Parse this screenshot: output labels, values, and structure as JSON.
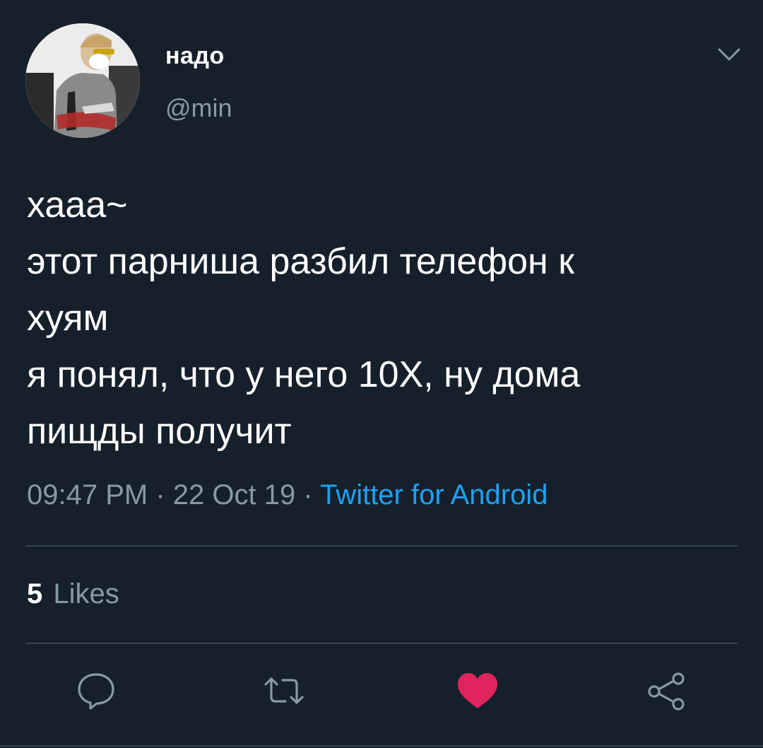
{
  "user": {
    "display_name": "надо",
    "handle": "@min"
  },
  "tweet": {
    "lines": [
      "хааа~",
      "этот парниша разбил телефон к",
      "хуям",
      "я понял, что у него 10Х, ну дома",
      "пищды получит"
    ],
    "time": "09:47 PM",
    "date": "22 Oct 19",
    "separator": "·",
    "source": "Twitter for Android"
  },
  "stats": {
    "likes_count": "5",
    "likes_label": "Likes"
  },
  "actions": {
    "liked": true
  },
  "colors": {
    "background": "#15202b",
    "secondary_text": "#8899a6",
    "link": "#1da1f2",
    "like_red": "#e0245e",
    "divider": "#38444d"
  },
  "icons": [
    "chevron-down-icon",
    "reply-icon",
    "retweet-icon",
    "heart-icon",
    "share-icon"
  ]
}
